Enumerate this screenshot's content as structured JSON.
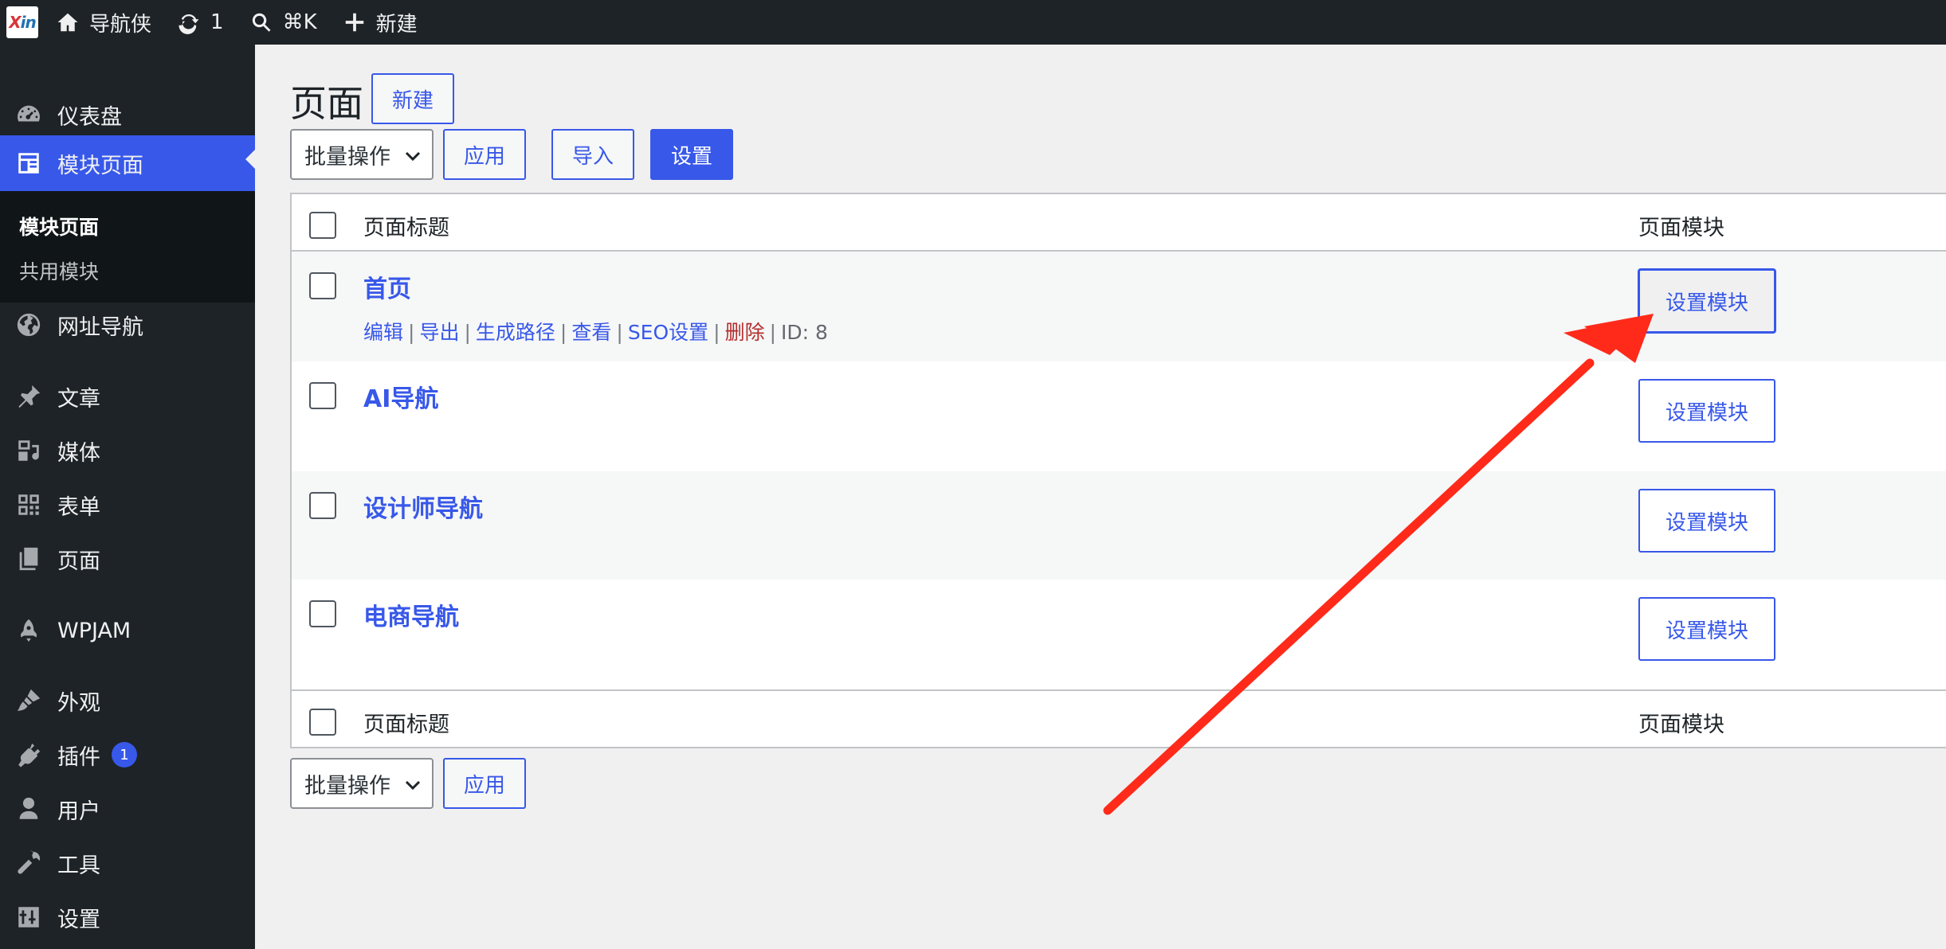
{
  "adminbar": {
    "site_name": "导航侠",
    "updates_count": "1",
    "search_shortcut": "⌘K",
    "new_label": "新建"
  },
  "sidebar": {
    "items": [
      {
        "label": "仪表盘",
        "icon": "dashboard-icon"
      },
      {
        "label": "模块页面",
        "icon": "layout-icon",
        "current": true
      },
      {
        "label": "网址导航",
        "icon": "globe-icon"
      },
      {
        "label": "文章",
        "icon": "pin-icon"
      },
      {
        "label": "媒体",
        "icon": "media-icon"
      },
      {
        "label": "表单",
        "icon": "grid-icon"
      },
      {
        "label": "页面",
        "icon": "pages-icon"
      },
      {
        "label": "WPJAM",
        "icon": "rocket-icon"
      },
      {
        "label": "外观",
        "icon": "brush-icon"
      },
      {
        "label": "插件",
        "icon": "plugin-icon",
        "badge": "1"
      },
      {
        "label": "用户",
        "icon": "user-icon"
      },
      {
        "label": "工具",
        "icon": "wrench-icon"
      },
      {
        "label": "设置",
        "icon": "settings-icon"
      }
    ],
    "submenu": [
      "模块页面",
      "共用模块"
    ]
  },
  "main": {
    "title": "页面",
    "new_button": "新建",
    "bulk_select": "批量操作",
    "apply_button": "应用",
    "import_button": "导入",
    "settings_button": "设置",
    "table": {
      "col_title": "页面标题",
      "col_module": "页面模块",
      "rows": [
        {
          "title": "首页",
          "module_button": "设置模块"
        },
        {
          "title": "AI导航",
          "module_button": "设置模块"
        },
        {
          "title": "设计师导航",
          "module_button": "设置模块"
        },
        {
          "title": "电商导航",
          "module_button": "设置模块"
        }
      ],
      "row_actions": {
        "edit": "编辑",
        "export": "导出",
        "route": "生成路径",
        "view": "查看",
        "seo": "SEO设置",
        "delete": "删除",
        "id": "ID: 8"
      }
    }
  },
  "colors": {
    "accent": "#3858e9",
    "sidebar_bg": "#1d2327",
    "annotation_arrow": "#ff2a1a"
  }
}
